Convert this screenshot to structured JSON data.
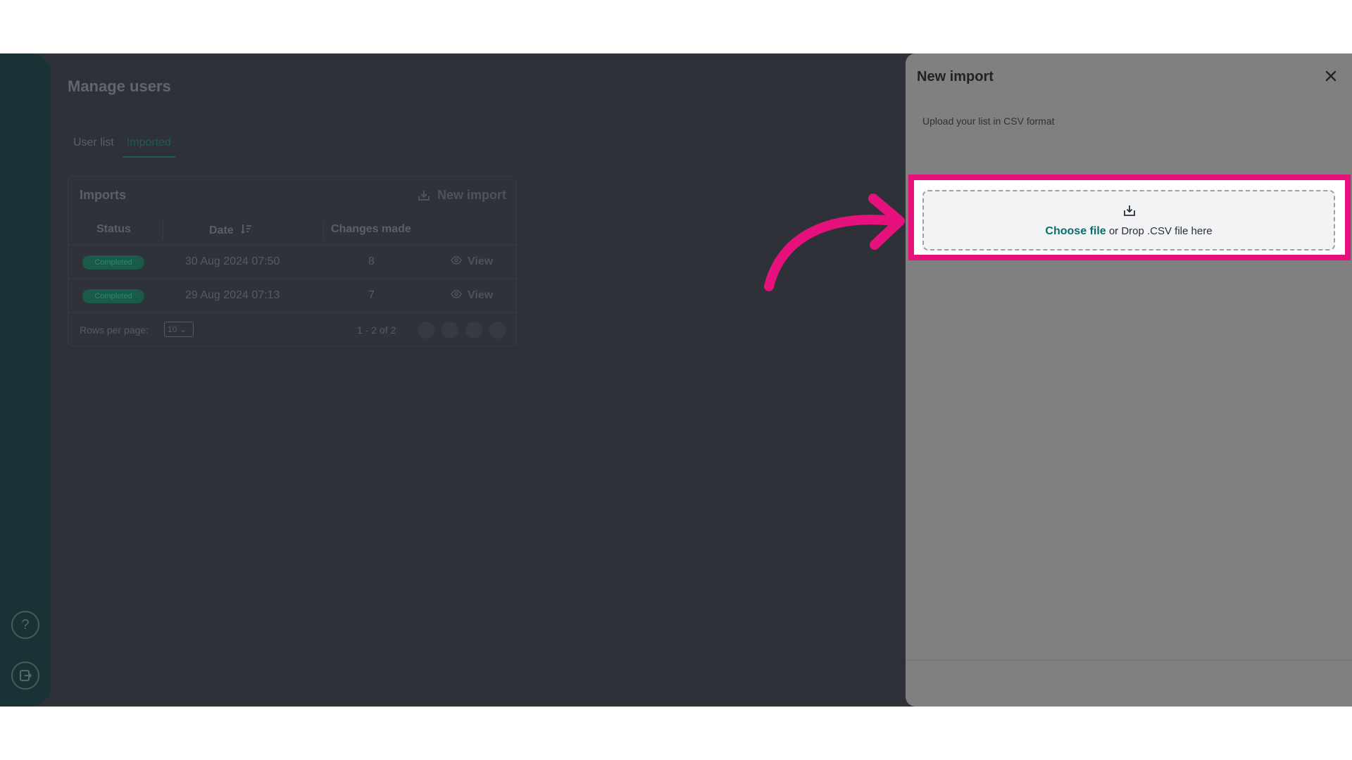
{
  "page": {
    "title": "Manage users",
    "tabs": [
      {
        "label": "User list",
        "active": false
      },
      {
        "label": "Imported",
        "active": true
      }
    ]
  },
  "imports": {
    "title": "Imports",
    "new_import_label": "New import",
    "columns": [
      "Status",
      "Date",
      "Changes made"
    ],
    "rows": [
      {
        "status": "Completed",
        "date": "30 Aug 2024 07:50",
        "changes": "8",
        "action": "View"
      },
      {
        "status": "Completed",
        "date": "29 Aug 2024 07:13",
        "changes": "7",
        "action": "View"
      }
    ],
    "rows_per_page_label": "Rows per page:",
    "rows_per_page_value": "10",
    "range_text": "1 - 2 of 2"
  },
  "drawer": {
    "title": "New import",
    "hint": "Upload your list in CSV format",
    "choose_file": "Choose file",
    "drop_text": " or Drop .CSV file here"
  },
  "colors": {
    "highlight": "#e6117d",
    "accent": "#0b6e66"
  }
}
